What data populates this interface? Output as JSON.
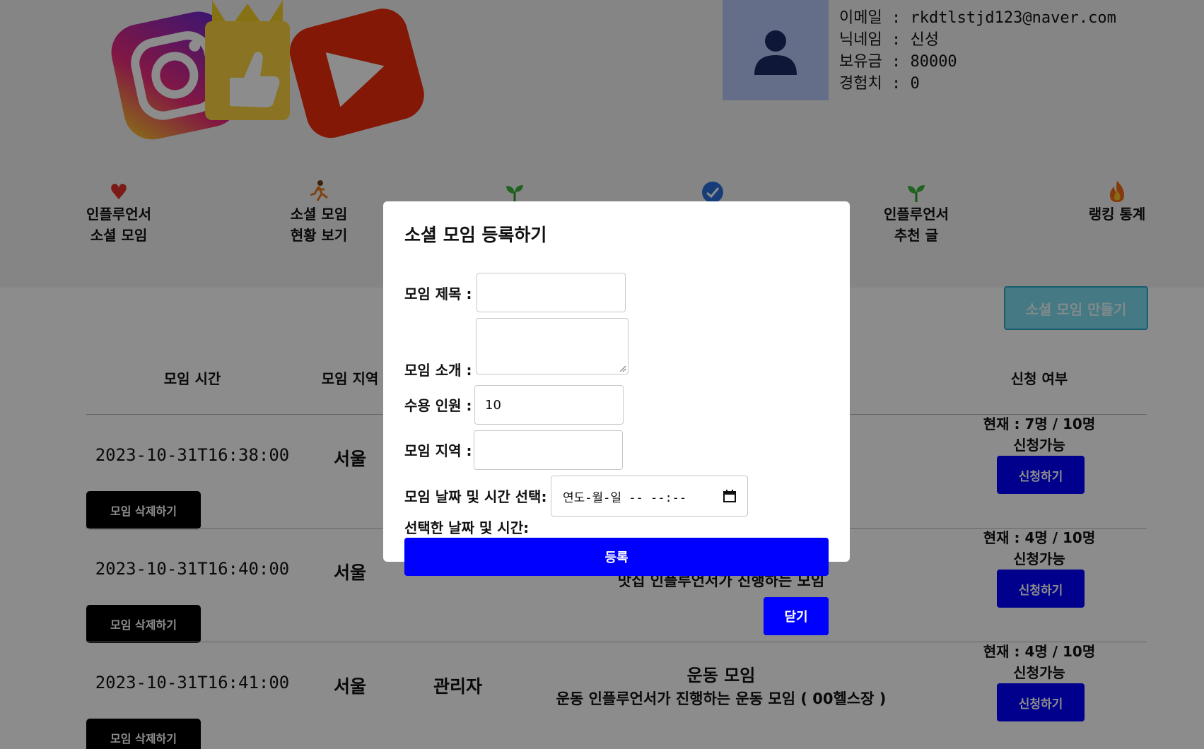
{
  "profile": {
    "email": "이메일 : rkdtlstjd123@naver.com",
    "nickname": "닉네임 : 신성",
    "balance": "보유금 : 80000",
    "exp": "경험치 : 0"
  },
  "nav": {
    "items": [
      {
        "line1": "인플루언서",
        "line2": "소셜 모임",
        "icon": "heart-icon"
      },
      {
        "line1": "소셜 모임",
        "line2": "현황 보기",
        "icon": "runner-icon"
      },
      {
        "line1": "",
        "line2": "",
        "icon": "sprout-icon"
      },
      {
        "line1": "",
        "line2": "",
        "icon": "check-badge-icon"
      },
      {
        "line1": "인플루언서",
        "line2": "추천 글",
        "icon": "sprout-icon"
      },
      {
        "line1": "랭킹 통계",
        "line2": "",
        "icon": "fire-icon"
      }
    ]
  },
  "create_button": "소셜 모임 만들기",
  "table": {
    "headers": [
      "모임 시간",
      "모임 지역",
      "신청 여부"
    ],
    "rows": [
      {
        "time": "2023-10-31T16:38:00",
        "region": "서울",
        "host": "",
        "title": "",
        "desc": "",
        "status1": "현재 : 7명 / 10명",
        "status2": "신청가능",
        "apply": "신청하기",
        "delete": "모임 삭제하기"
      },
      {
        "time": "2023-10-31T16:40:00",
        "region": "서울",
        "host": "",
        "title": "",
        "desc": "맛집 인플루언서가 진행하는 모임",
        "status1": "현재 : 4명 / 10명",
        "status2": "신청가능",
        "apply": "신청하기",
        "delete": "모임 삭제하기"
      },
      {
        "time": "2023-10-31T16:41:00",
        "region": "서울",
        "host": "관리자",
        "title": "운동 모임",
        "desc": "운동 인플루언서가 진행하는 운동 모임 ( 00헬스장 )",
        "status1": "현재 : 4명 / 10명",
        "status2": "신청가능",
        "apply": "신청하기",
        "delete": "모임 삭제하기"
      }
    ]
  },
  "close_button": "닫기",
  "modal": {
    "title": "소셜 모임 등록하기",
    "title_label": "모임 제목 :",
    "intro_label": "모임 소개 :",
    "capacity_label": "수용 인원 :",
    "capacity_value": "10",
    "region_label": "모임 지역 :",
    "datetime_label": "모임 날짜 및 시간 선택:",
    "datetime_placeholder": "연도-월-일 -- --:--",
    "selected_label": "선택한 날짜 및 시간:",
    "submit": "등록"
  }
}
